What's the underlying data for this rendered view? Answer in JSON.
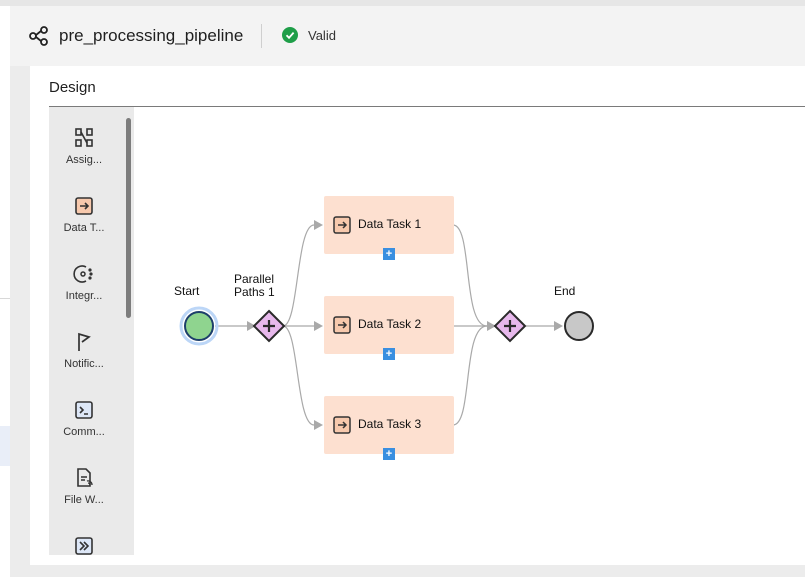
{
  "header": {
    "title": "pre_processing_pipeline",
    "status": "Valid",
    "colors": {
      "valid": "#1e9e48"
    }
  },
  "design": {
    "title": "Design"
  },
  "palette": {
    "items": [
      {
        "label": "Assig...",
        "icon": "assignment-icon"
      },
      {
        "label": "Data T...",
        "icon": "data-task-icon"
      },
      {
        "label": "Integr...",
        "icon": "integration-icon"
      },
      {
        "label": "Notific...",
        "icon": "notification-flag-icon"
      },
      {
        "label": "Comm...",
        "icon": "command-icon"
      },
      {
        "label": "File W...",
        "icon": "file-watcher-icon"
      },
      {
        "label": "",
        "icon": "next-step-icon"
      }
    ]
  },
  "flow": {
    "start_label": "Start",
    "parallel_label_line1": "Parallel",
    "parallel_label_line2": "Paths 1",
    "end_label": "End",
    "tasks": [
      {
        "name": "Data Task 1"
      },
      {
        "name": "Data Task 2"
      },
      {
        "name": "Data Task 3"
      }
    ],
    "colors": {
      "task_fill": "#fde0d0",
      "gateway_fill": "#e7b8ec",
      "start_fill": "#8fd48f",
      "end_fill": "#c8c8c8"
    }
  }
}
